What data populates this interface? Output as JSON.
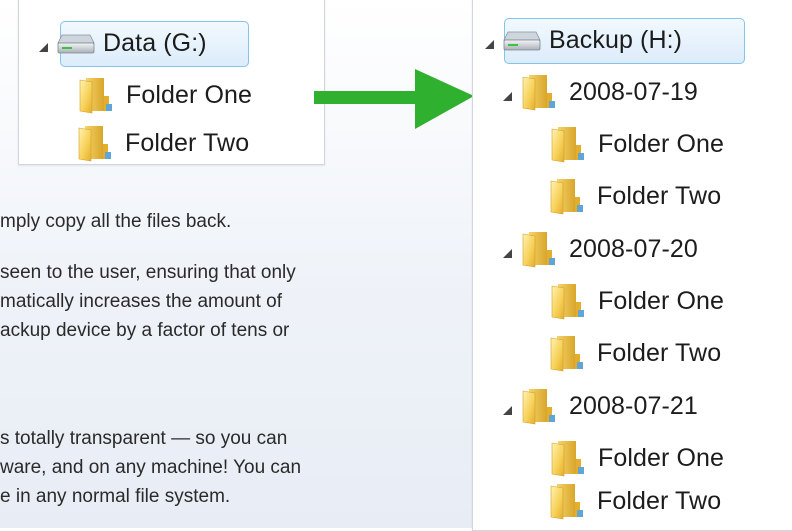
{
  "left_tree": {
    "drive": {
      "label": "Data (G:)"
    },
    "folders": [
      {
        "label": "Folder One",
        "expandable": true
      },
      {
        "label": "Folder Two",
        "expandable": false
      }
    ]
  },
  "arrow": {
    "color": "#2fb02f",
    "direction": "right"
  },
  "right_tree": {
    "drive": {
      "label": "Backup (H:)"
    },
    "snapshots": [
      {
        "label": "2008-07-19",
        "folders": [
          {
            "label": "Folder One"
          },
          {
            "label": "Folder Two"
          }
        ]
      },
      {
        "label": "2008-07-20",
        "folders": [
          {
            "label": "Folder One"
          },
          {
            "label": "Folder Two"
          }
        ]
      },
      {
        "label": "2008-07-21",
        "folders": [
          {
            "label": "Folder One"
          },
          {
            "label": "Folder Two"
          }
        ]
      }
    ]
  },
  "text": {
    "line1": "mply copy all the files back.",
    "para2_line1": "seen to the user, ensuring that only",
    "para2_line2": "matically increases the amount of",
    "para2_line3": "ackup device by a factor of tens or",
    "para3_line1": "s totally transparent — so you can",
    "para3_line2": "ware, and on any machine! You can",
    "para3_line3": "e in any normal file system."
  },
  "colors": {
    "selection_border": "#84c3ea",
    "selection_fill": "#dcecfa",
    "folder": "#e6b83a"
  }
}
